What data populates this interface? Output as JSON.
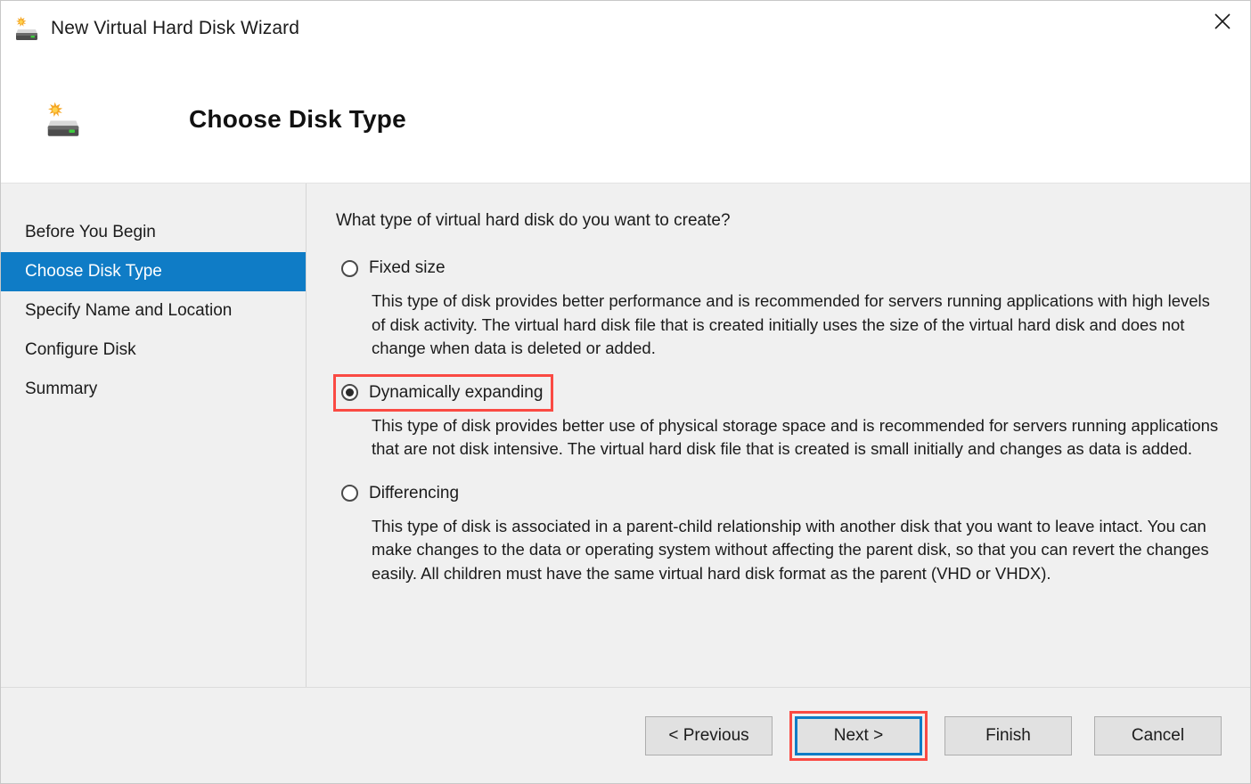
{
  "window": {
    "title": "New Virtual Hard Disk Wizard",
    "title_icon": "virtual-hard-disk-icon",
    "close_label": "✕"
  },
  "header": {
    "title": "Choose Disk Type",
    "icon": "virtual-hard-disk-icon"
  },
  "sidebar": {
    "items": [
      {
        "label": "Before You Begin",
        "selected": false
      },
      {
        "label": "Choose Disk Type",
        "selected": true
      },
      {
        "label": "Specify Name and Location",
        "selected": false
      },
      {
        "label": "Configure Disk",
        "selected": false
      },
      {
        "label": "Summary",
        "selected": false
      }
    ]
  },
  "main": {
    "question": "What type of virtual hard disk do you want to create?",
    "options": [
      {
        "label": "Fixed size",
        "checked": false,
        "annotated": false,
        "description": "This type of disk provides better performance and is recommended for servers running applications with high levels of disk activity. The virtual hard disk file that is created initially uses the size of the virtual hard disk and does not change when data is deleted or added."
      },
      {
        "label": "Dynamically expanding",
        "checked": true,
        "annotated": true,
        "description": "This type of disk provides better use of physical storage space and is recommended for servers running applications that are not disk intensive. The virtual hard disk file that is created is small initially and changes as data is added."
      },
      {
        "label": "Differencing",
        "checked": false,
        "annotated": false,
        "description": "This type of disk is associated in a parent-child relationship with another disk that you want to leave intact. You can make changes to the data or operating system without affecting the parent disk, so that you can revert the changes easily. All children must have the same virtual hard disk format as the parent (VHD or VHDX)."
      }
    ]
  },
  "footer": {
    "buttons": [
      {
        "label": "< Previous",
        "focused": false,
        "annotated": false
      },
      {
        "label": "Next >",
        "focused": true,
        "annotated": true
      },
      {
        "label": "Finish",
        "focused": false,
        "annotated": false
      },
      {
        "label": "Cancel",
        "focused": false,
        "annotated": false
      }
    ]
  },
  "colors": {
    "accent_blue": "#0f7cc6",
    "annotation_red": "#fa4a43",
    "body_background": "#f0f0f0",
    "button_face": "#e1e1e1",
    "button_border": "#adadad"
  }
}
